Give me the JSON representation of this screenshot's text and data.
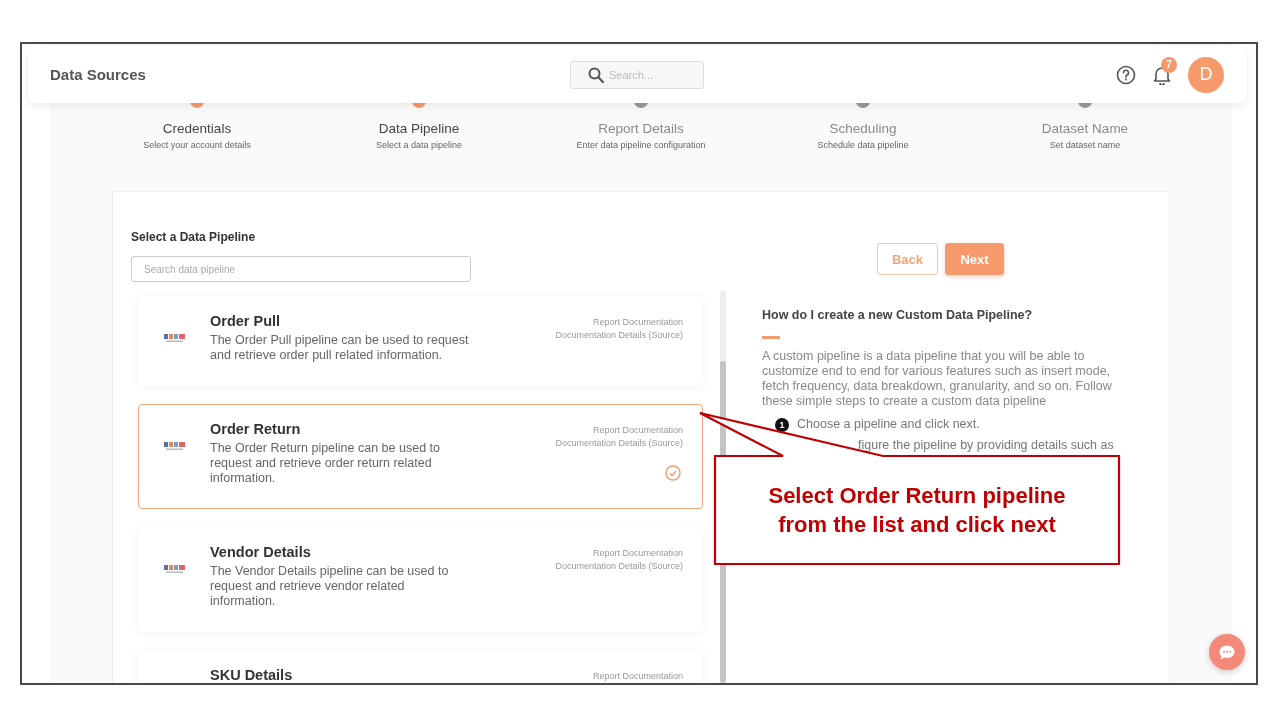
{
  "header": {
    "title": "Data Sources",
    "search": {
      "placeholder": "Search..."
    },
    "notifications": "7",
    "avatar": "D"
  },
  "steps": [
    {
      "label": "Credentials",
      "hint": "Select your account details",
      "reached": true
    },
    {
      "label": "Data Pipeline",
      "hint": "Select a data pipeline",
      "reached": true
    },
    {
      "label": "Report Details",
      "hint": "Enter data pipeline configuration",
      "reached": false
    },
    {
      "label": "Scheduling",
      "hint": "Schedule data pipeline",
      "reached": false
    },
    {
      "label": "Dataset Name",
      "hint": "Set dataset name",
      "reached": false
    }
  ],
  "section_title": "Select a Data Pipeline",
  "pipeline_search": {
    "placeholder": "Search data pipeline"
  },
  "buttons": [
    {
      "label": "Back",
      "kind": "outline"
    },
    {
      "label": "Next",
      "kind": "filled"
    }
  ],
  "pipelines": [
    {
      "name": "Order Pull",
      "description": "The Order Pull pipeline can be used to request and retrieve order pull related information.",
      "links": [
        "Report Documentation",
        "Documentation Details (Source)"
      ],
      "selected": false
    },
    {
      "name": "Order Return",
      "description": "The Order Return pipeline can be used to request and retrieve order return related information.",
      "links": [
        "Report Documentation",
        "Documentation Details (Source)"
      ],
      "selected": true
    },
    {
      "name": "Vendor Details",
      "description": "The Vendor Details pipeline can be used to request and retrieve vendor related information.",
      "links": [
        "Report Documentation",
        "Documentation Details (Source)"
      ],
      "selected": false
    },
    {
      "name": "SKU Details",
      "links": [
        "Report Documentation"
      ],
      "selected": false
    }
  ],
  "help": {
    "title": "How do I create a new Custom Data Pipeline?",
    "body": "A custom pipeline is a data pipeline that you will be able to customize end to end for various features such as insert mode, fetch frequency, data breakdown, granularity, and so on. Follow these simple steps to create a custom data pipeline",
    "steps": [
      {
        "number": "1",
        "text": "Choose a pipeline and click next."
      },
      {
        "text": "figure the pipeline by providing details such as"
      }
    ]
  },
  "callout": {
    "text": "Select Order Return pipeline from the list and click next"
  }
}
